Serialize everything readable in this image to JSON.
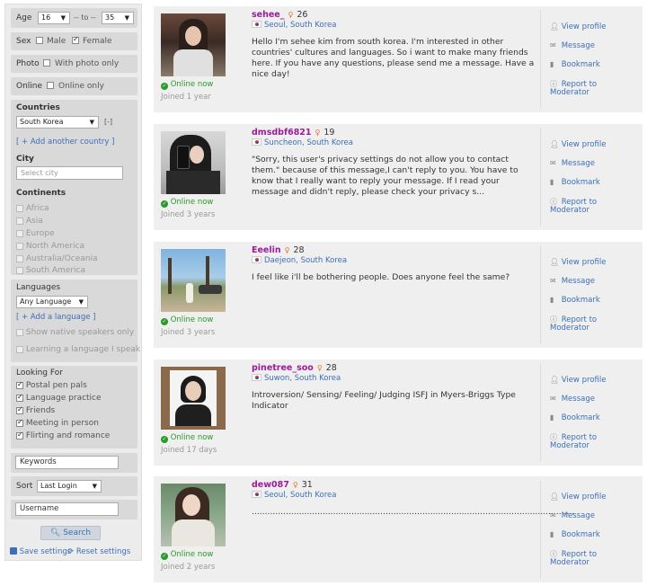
{
  "filters": {
    "age_label": "Age",
    "age_from": "16",
    "age_sep": "-- to --",
    "age_to": "35",
    "sex_label": "Sex",
    "male_label": "Male",
    "female_label": "Female",
    "photo_label": "Photo",
    "photo_option": "With photo only",
    "online_label": "Online",
    "online_option": "Online only",
    "countries_label": "Countries",
    "country_value": "South Korea",
    "remove_country": "[-]",
    "add_country": "[ + Add another country ]",
    "city_label": "City",
    "city_placeholder": "Select city",
    "continents_label": "Continents",
    "continents": [
      "Africa",
      "Asia",
      "Europe",
      "North America",
      "Australia/Oceania",
      "South America"
    ],
    "languages_label": "Languages",
    "language_value": "Any Language",
    "add_language": "[ + Add a language ]",
    "native_only": "Show native speakers only",
    "learning_lang": "Learning a language I speak",
    "looking_for_label": "Looking For",
    "looking_for": [
      "Postal pen pals",
      "Language practice",
      "Friends",
      "Meeting in person",
      "Flirting and romance"
    ],
    "keywords_placeholder": "Keywords",
    "sort_label": "Sort",
    "sort_value": "Last Login",
    "username_placeholder": "Username",
    "search_button": "Search",
    "save_settings": "Save settings",
    "reset_settings": "Reset settings"
  },
  "profiles": [
    {
      "name": "sehee_",
      "age": "26",
      "city": "Seoul",
      "country": "South Korea",
      "status": "Online now",
      "joined": "Joined 1 year",
      "bio": "Hello I'm sehee kim from south korea. I'm interested in other countries' cultures and languages. So i want to make many friends here. If you have any questions, please send me a message. Have a nice day!"
    },
    {
      "name": "dmsdbf6821",
      "age": "19",
      "city": "Suncheon",
      "country": "South Korea",
      "status": "Online now",
      "joined": "Joined 3 years",
      "bio": "\"Sorry, this user's privacy settings do not allow you to contact them.\" because of this message,I can't reply to you. You have to know that I really want to reply your message. If I read your message and didn't reply, please check your privacy s..."
    },
    {
      "name": "Eeelin",
      "age": "28",
      "city": "Daejeon",
      "country": "South Korea",
      "status": "Online now",
      "joined": "Joined 3 years",
      "bio": "I feel like i'll be bothering people. Does anyone feel the same?"
    },
    {
      "name": "pinetree_soo",
      "age": "28",
      "city": "Suwon",
      "country": "South Korea",
      "status": "Online now",
      "joined": "Joined 17 days",
      "bio": "Introversion/ Sensing/ Feeling/ Judging ISFJ in Myers-Briggs Type Indicator"
    },
    {
      "name": "dew087",
      "age": "31",
      "city": "Seoul",
      "country": "South Korea",
      "status": "Online now",
      "joined": "Joined 2 years",
      "bio": "..........................................................................................................................."
    }
  ],
  "actions": {
    "view_profile": "View profile",
    "message": "Message",
    "bookmark": "Bookmark",
    "report_to": "Report to",
    "moderator": "Moderator"
  },
  "colors": {
    "username": "#9b1c9b",
    "link": "#3d6fb6",
    "online": "#2a9a2a",
    "female_icon": "#e8712b"
  }
}
